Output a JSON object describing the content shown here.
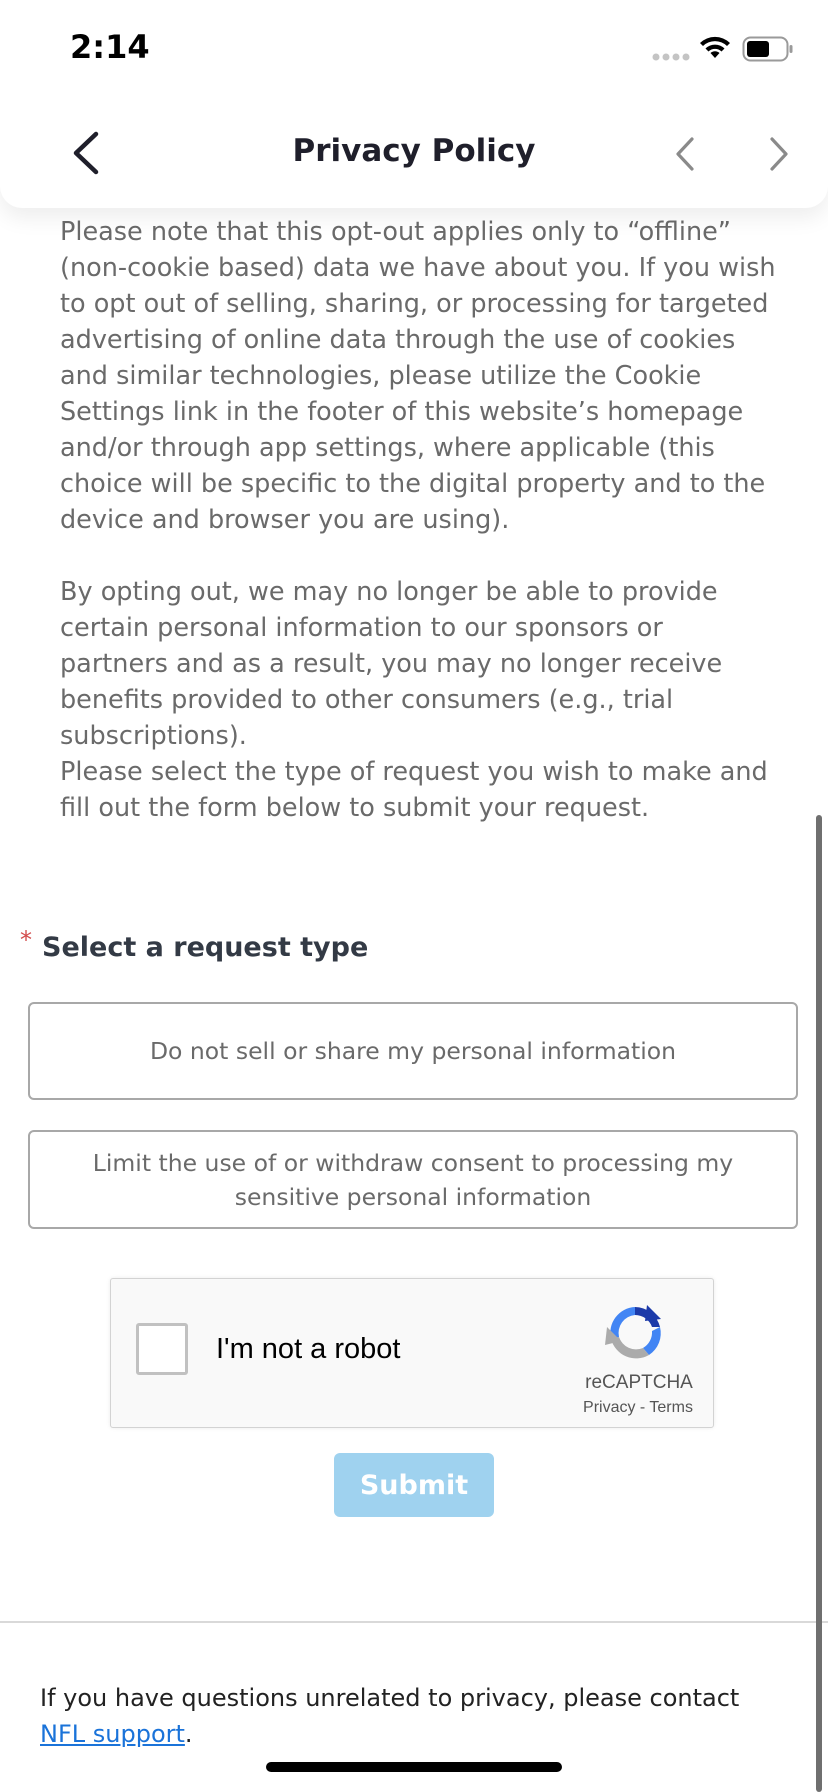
{
  "status_bar": {
    "time": "2:14"
  },
  "nav": {
    "title": "Privacy Policy",
    "back_icon": "chevron-left-icon",
    "prev_icon": "chevron-left-icon",
    "next_icon": "chevron-right-icon"
  },
  "content": {
    "paragraphs": [
      "Please note that this opt-out applies only to “offline” (non-cookie based) data we have about you. If you wish to opt out of selling, sharing, or processing for targeted advertising of online data through the use of cookies and similar technologies, please utilize the Cookie Settings link in the footer of this website’s homepage and/or through app settings, where applicable (this choice will be specific to the digital property and to the device and browser you are using).",
      "By opting out, we may no longer be able to provide certain personal information to our sponsors or partners and as a result, you may no longer receive benefits provided to other consumers (e.g., trial subscriptions).",
      "Please select the type of request you wish to make and fill out the form below to submit your request."
    ]
  },
  "form": {
    "required_marker": "*",
    "request_type_label": "Select a request type",
    "options": [
      "Do not sell or share my personal information",
      "Limit the use of or withdraw consent to processing my sensitive personal information"
    ],
    "recaptcha": {
      "label": "I'm not a robot",
      "brand": "reCAPTCHA",
      "privacy": "Privacy",
      "separator": "-",
      "terms": "Terms"
    },
    "submit_label": "Submit"
  },
  "footer": {
    "text": "If you have questions unrelated to privacy, please contact ",
    "link": "NFL support",
    "suffix": "."
  },
  "colors": {
    "submit_bg": "#9fd2ef",
    "link": "#1a73d9",
    "required": "#d24b4b"
  }
}
